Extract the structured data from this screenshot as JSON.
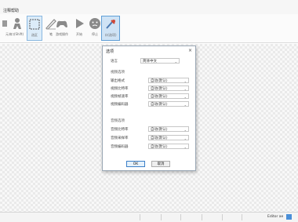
{
  "menu": {
    "label": "注释帮助"
  },
  "toolbar": {
    "items": [
      {
        "name": "tool-a",
        "label": "元本"
      },
      {
        "name": "tool-b",
        "label": "口(Shift)"
      },
      {
        "name": "tool-c",
        "label": "选区"
      },
      {
        "name": "tool-d",
        "label": "笔"
      },
      {
        "name": "tool-e",
        "label": "游戏操作"
      },
      {
        "name": "tool-f",
        "label": "开始"
      },
      {
        "name": "tool-g",
        "label": "停止"
      },
      {
        "name": "tool-h",
        "label": "口(选项)"
      }
    ]
  },
  "dialog": {
    "title": "选项",
    "close": "×",
    "language": {
      "label": "语言",
      "value": "简体中文"
    },
    "video_section": "视频选项",
    "video_rows": [
      {
        "label": "输出格式",
        "value": "自动(默认)"
      },
      {
        "label": "视频比特率",
        "value": "自动(默认)"
      },
      {
        "label": "视频帧速率",
        "value": "自动(默认)"
      },
      {
        "label": "视频编码器",
        "value": "自动(默认)"
      }
    ],
    "audio_section": "音频选项",
    "audio_rows": [
      {
        "label": "音频比特率",
        "value": "自动(默认)"
      },
      {
        "label": "音频采样率",
        "value": "自动(默认)"
      },
      {
        "label": "音频编码器",
        "value": "自动(默认)"
      }
    ],
    "ok": "OK",
    "cancel": "取消"
  },
  "status": {
    "text": "Editor ae"
  },
  "colors": {
    "accent": "#5f9ed6",
    "dialog_border": "#9aa7b4"
  }
}
